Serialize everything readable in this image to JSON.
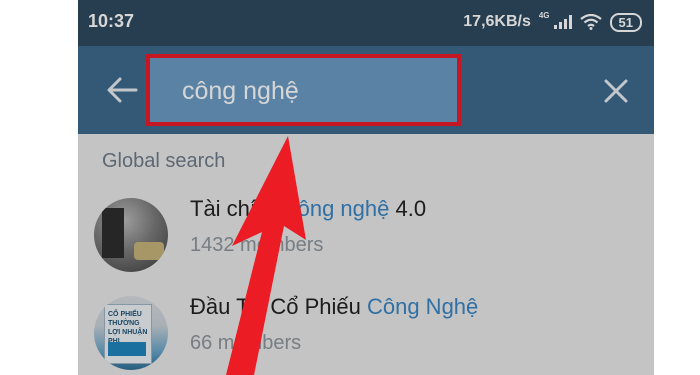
{
  "status_bar": {
    "time": "10:37",
    "speed": "17,6KB/s",
    "network": "4G",
    "battery": "51"
  },
  "search": {
    "query": "công nghệ",
    "back_icon": "arrow-left-icon",
    "clear_icon": "close-icon"
  },
  "section": {
    "title": "Global search"
  },
  "results": [
    {
      "name_prefix": "Tài chính ",
      "name_highlight": "công nghệ",
      "name_suffix": " 4.0",
      "members": "1432 members"
    },
    {
      "name_prefix": "Đầu Tư Cổ Phiếu ",
      "name_highlight": "Công Nghệ",
      "name_suffix": "",
      "members": "66 members"
    }
  ],
  "avatar2_text": "CỔ PHIẾU THƯỜNG LỢI NHUẬN PHI THƯỜNG",
  "colors": {
    "status_bar": "#2f4a61",
    "toolbar": "#3f6a8d",
    "search_box": "#6a9bc4",
    "highlight_border": "#ea1c2a",
    "match_text": "#3a86c5",
    "annotation_arrow": "#ec1c24"
  }
}
